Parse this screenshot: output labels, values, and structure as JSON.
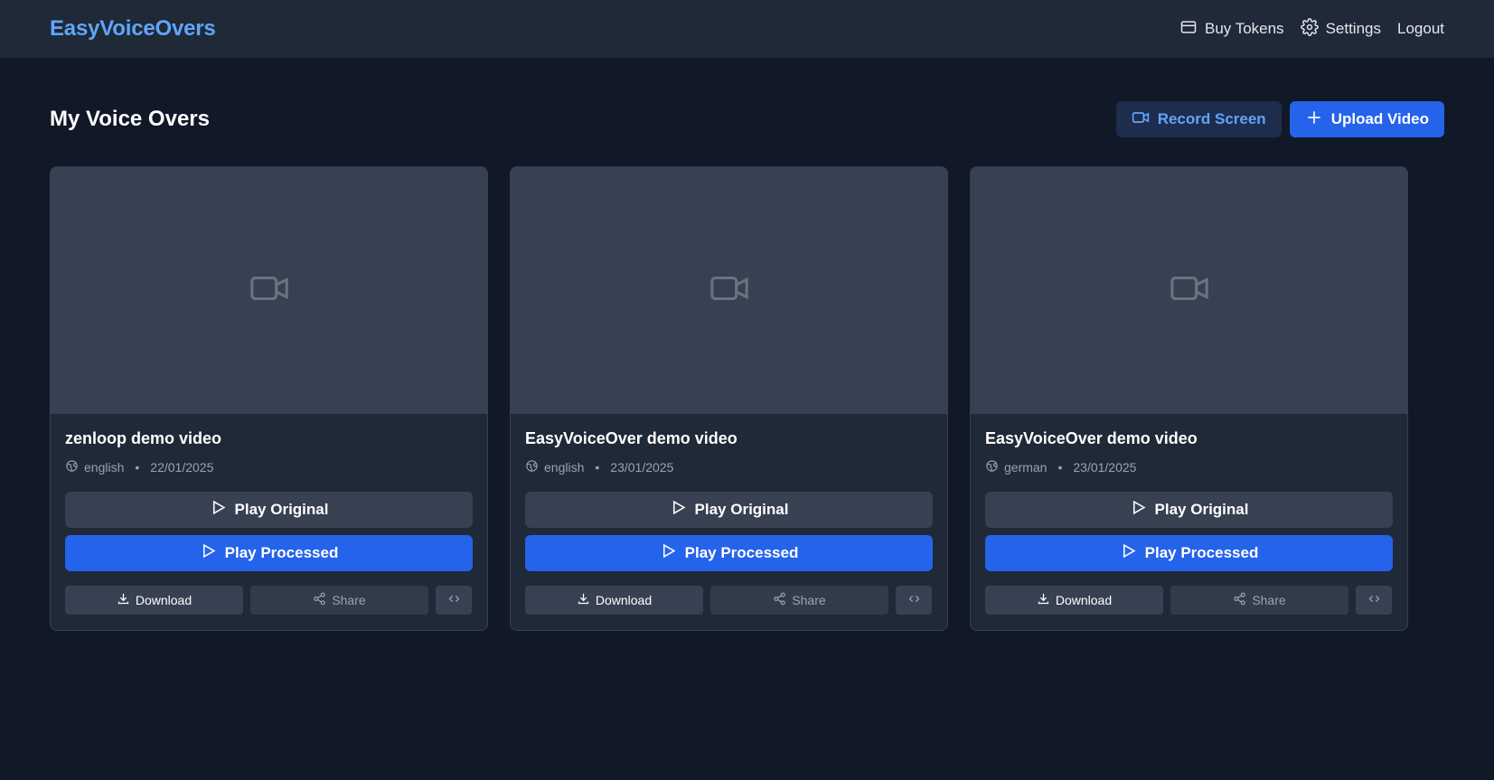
{
  "header": {
    "brand": "EasyVoiceOvers",
    "nav": [
      {
        "label": "Buy Tokens",
        "icon": "credit-card-icon"
      },
      {
        "label": "Settings",
        "icon": "gear-icon"
      },
      {
        "label": "Logout",
        "icon": ""
      }
    ]
  },
  "page": {
    "title": "My Voice Overs",
    "record_label": "Record Screen",
    "upload_label": "Upload Video"
  },
  "cards": [
    {
      "title": "zenloop demo video",
      "language": "english",
      "date": "22/01/2025",
      "play_original": "Play Original",
      "play_processed": "Play Processed",
      "download": "Download",
      "share": "Share"
    },
    {
      "title": "EasyVoiceOver demo video",
      "language": "english",
      "date": "23/01/2025",
      "play_original": "Play Original",
      "play_processed": "Play Processed",
      "download": "Download",
      "share": "Share"
    },
    {
      "title": "EasyVoiceOver demo video",
      "language": "german",
      "date": "23/01/2025",
      "play_original": "Play Original",
      "play_processed": "Play Processed",
      "download": "Download",
      "share": "Share"
    }
  ],
  "colors": {
    "background": "#111827",
    "surface": "#1f2937",
    "accent": "#2563eb",
    "brand": "#60a5fa"
  }
}
